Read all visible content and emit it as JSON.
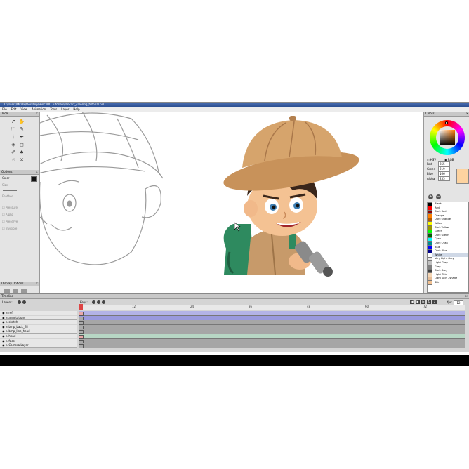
{
  "window": {
    "title": "C:/Users/MORE/Desktop/PencilDO Tutorials/lancart_coloring_tutorial.pcl"
  },
  "menu": [
    "File",
    "Edit",
    "View",
    "Animation",
    "Tools",
    "Layer",
    "Help"
  ],
  "tools_panel": {
    "title": "Tools"
  },
  "options_panel": {
    "title": "Options",
    "color_label": "Color",
    "size_label": "Size",
    "feather_label": "Feather",
    "checks": [
      "Pressure",
      "Alpha",
      "Preserve",
      "Invisible"
    ]
  },
  "display_panel": {
    "title": "Display Options"
  },
  "colors_panel": {
    "title": "Colors",
    "modes": [
      "HSV",
      "RGB"
    ],
    "selected_mode": "RGB",
    "channels": [
      {
        "label": "Red",
        "value": "255"
      },
      {
        "label": "Green",
        "value": "219"
      },
      {
        "label": "Blue",
        "value": "166"
      },
      {
        "label": "Alpha",
        "value": "255"
      }
    ],
    "preview_color": "#fdd3a0",
    "palette": [
      {
        "name": "Black",
        "color": "#000000"
      },
      {
        "name": "Red",
        "color": "#ff0000"
      },
      {
        "name": "Dark Red",
        "color": "#8b0000"
      },
      {
        "name": "Orange",
        "color": "#ff8000"
      },
      {
        "name": "Dark Orange",
        "color": "#b35900"
      },
      {
        "name": "Yellow",
        "color": "#ffff00"
      },
      {
        "name": "Dark Yellow",
        "color": "#999900"
      },
      {
        "name": "Green",
        "color": "#00ff00"
      },
      {
        "name": "Dark Green",
        "color": "#006400"
      },
      {
        "name": "Cyan",
        "color": "#00ffff"
      },
      {
        "name": "Dark Cyan",
        "color": "#008b8b"
      },
      {
        "name": "Blue",
        "color": "#0000ff"
      },
      {
        "name": "Dark Blue",
        "color": "#00008b"
      },
      {
        "name": "White",
        "color": "#ffffff"
      },
      {
        "name": "Very Light Grey",
        "color": "#e8e8e8"
      },
      {
        "name": "Light Grey",
        "color": "#c0c0c0"
      },
      {
        "name": "Grey",
        "color": "#808080"
      },
      {
        "name": "Dark Grey",
        "color": "#404040"
      },
      {
        "name": "Light Skin",
        "color": "#f5d6b4"
      },
      {
        "name": "Light Skin - shade",
        "color": "#e6bd97"
      },
      {
        "name": "Skin",
        "color": "#f2c191"
      }
    ]
  },
  "timeline": {
    "title": "Timeline",
    "layers_label": "Layers:",
    "keys_label": "Keys:",
    "ticks": [
      "12",
      "24",
      "36",
      "48",
      "60",
      "72"
    ],
    "fps_label": "fps:",
    "fps_value": "12",
    "layers": [
      {
        "name": "ref",
        "color": "#b3b3e6"
      },
      {
        "name": "annotations",
        "color": "#9999dd"
      },
      {
        "name": "sketch",
        "color": "#a6a6a6"
      },
      {
        "name": "bmp_back_fill",
        "color": "#a6a6a6"
      },
      {
        "name": "bmp_line_head",
        "color": "#a6a6a6"
      },
      {
        "name": "head",
        "color": "#b7d6c4"
      },
      {
        "name": "face",
        "color": "#a6a6a6"
      },
      {
        "name": "Camera Layer",
        "color": "#a6a6a6"
      }
    ]
  }
}
